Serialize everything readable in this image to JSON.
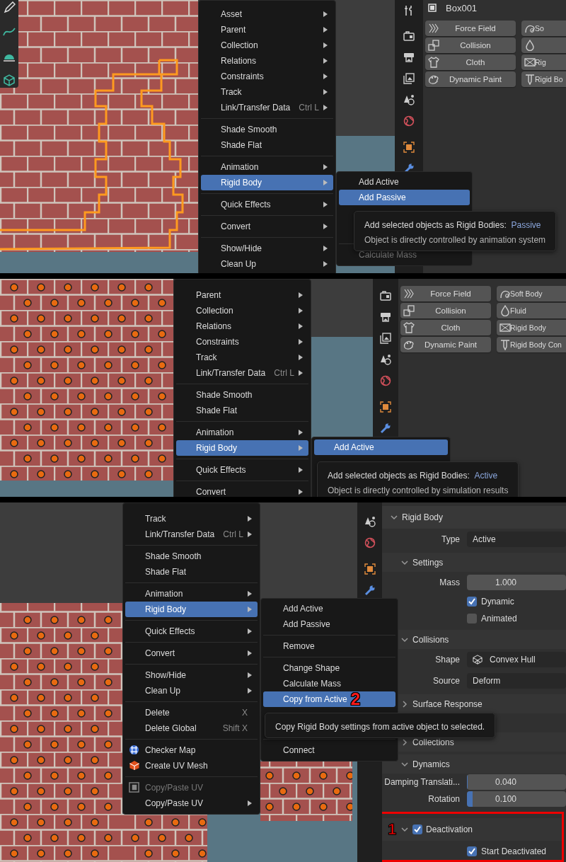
{
  "panels": [
    {
      "kind": "physics",
      "toolbar": {
        "tools": [
          {
            "kind": "pencil"
          },
          {
            "kind": "curve"
          },
          {
            "kind": "dome"
          },
          {
            "kind": "cube"
          }
        ]
      },
      "menu": {
        "groups": [
          [
            {
              "label": "Asset",
              "submenu": true,
              "selected": false
            },
            {
              "label": "Parent",
              "submenu": true,
              "selected": false
            },
            {
              "label": "Collection",
              "submenu": true,
              "selected": false
            },
            {
              "label": "Relations",
              "submenu": true,
              "selected": false
            },
            {
              "label": "Constraints",
              "submenu": true,
              "selected": false
            },
            {
              "label": "Track",
              "submenu": true,
              "selected": false
            },
            {
              "label": "Link/Transfer Data",
              "shortcut": "Ctrl L",
              "submenu": true,
              "selected": false
            }
          ],
          [
            {
              "label": "Shade Smooth",
              "submenu": false,
              "selected": false
            },
            {
              "label": "Shade Flat",
              "submenu": false,
              "selected": false
            }
          ],
          [
            {
              "label": "Animation",
              "submenu": true,
              "selected": false
            },
            {
              "label": "Rigid Body",
              "submenu": true,
              "selected": true
            }
          ],
          [
            {
              "label": "Quick Effects",
              "submenu": true,
              "selected": false
            }
          ],
          [
            {
              "label": "Convert",
              "submenu": true,
              "selected": false
            }
          ],
          [
            {
              "label": "Show/Hide",
              "submenu": true,
              "selected": false
            },
            {
              "label": "Clean Up",
              "submenu": true,
              "selected": false
            }
          ]
        ]
      },
      "submenu": {
        "groups": [
          [
            {
              "label": "Add Active",
              "submenu": false,
              "selected": false,
              "disabled": false
            },
            {
              "label": "Add Passive",
              "submenu": false,
              "selected": true,
              "disabled": false
            }
          ],
          [
            {
              "label": "Calculate Mass",
              "submenu": false,
              "selected": false,
              "disabled": true
            }
          ]
        ]
      },
      "tooltip": {
        "text": "Add selected objects as Rigid Bodies:",
        "value": "Passive",
        "description": "Object is directly controlled by animation system"
      },
      "properties": {
        "object_name": "Box001",
        "tabs": [
          {
            "kind": "tool"
          },
          {
            "kind": "render"
          },
          {
            "kind": "output"
          },
          {
            "kind": "view_layer"
          },
          {
            "kind": "scene"
          },
          {
            "kind": "world"
          },
          {
            "kind": "object"
          },
          {
            "kind": "modifier"
          }
        ],
        "physics_buttons": [
          {
            "label": "Force Field",
            "kind": "force_field"
          },
          {
            "label": "So",
            "kind": "soft_body"
          },
          {
            "label": "Collision",
            "kind": "collision"
          },
          {
            "kind": "fluid"
          },
          {
            "label": "Cloth",
            "kind": "cloth"
          },
          {
            "label": "Rig",
            "kind": "rigid_body"
          },
          {
            "label": "Dynamic Paint",
            "kind": "dynamic_paint"
          },
          {
            "label": "Rigid Bo",
            "kind": "rigid_body_constraint"
          }
        ]
      }
    },
    {
      "kind": "physics",
      "menu": {
        "groups": [
          [
            {
              "label": "Parent",
              "submenu": true,
              "selected": false
            },
            {
              "label": "Collection",
              "submenu": true,
              "selected": false
            },
            {
              "label": "Relations",
              "submenu": true,
              "selected": false
            },
            {
              "label": "Constraints",
              "submenu": true,
              "selected": false
            },
            {
              "label": "Track",
              "submenu": true,
              "selected": false
            },
            {
              "label": "Link/Transfer Data",
              "shortcut": "Ctrl L",
              "submenu": true,
              "selected": false
            }
          ],
          [
            {
              "label": "Shade Smooth",
              "submenu": false,
              "selected": false
            },
            {
              "label": "Shade Flat",
              "submenu": false,
              "selected": false
            }
          ],
          [
            {
              "label": "Animation",
              "submenu": true,
              "selected": false
            },
            {
              "label": "Rigid Body",
              "submenu": true,
              "selected": true
            }
          ],
          [
            {
              "label": "Quick Effects",
              "submenu": true,
              "selected": false
            }
          ],
          [
            {
              "label": "Convert",
              "submenu": true,
              "selected": false
            }
          ]
        ]
      },
      "submenu": {
        "groups": [
          [
            {
              "label": "Add Active",
              "submenu": false,
              "selected": true
            }
          ]
        ]
      },
      "tooltip": {
        "text": "Add selected objects as Rigid Bodies:",
        "value": "Active",
        "description": "Object is directly controlled by simulation results"
      },
      "properties": {
        "tabs": [
          {
            "kind": "render"
          },
          {
            "kind": "output"
          },
          {
            "kind": "view_layer"
          },
          {
            "kind": "scene"
          },
          {
            "kind": "world"
          },
          {
            "kind": "object"
          },
          {
            "kind": "modifier"
          }
        ],
        "physics_buttons": [
          {
            "label": "Force Field",
            "kind": "force_field"
          },
          {
            "label": "Soft Body",
            "kind": "soft_body"
          },
          {
            "label": "Collision",
            "kind": "collision"
          },
          {
            "label": "Fluid",
            "kind": "fluid"
          },
          {
            "label": "Cloth",
            "kind": "cloth"
          },
          {
            "label": "Rigid Body",
            "kind": "rigid_body"
          },
          {
            "label": "Dynamic Paint",
            "kind": "dynamic_paint"
          },
          {
            "label": "Rigid Body Con",
            "kind": "rigid_body_constraint"
          }
        ]
      }
    },
    {
      "kind": "rigid_body",
      "menu": {
        "groups": [
          [
            {
              "label": "Track",
              "kind": "plain",
              "submenu": true,
              "selected": false,
              "disabled": false
            },
            {
              "label": "Link/Transfer Data",
              "shortcut": "Ctrl L",
              "kind": "plain",
              "submenu": true,
              "selected": false,
              "disabled": false
            }
          ],
          [
            {
              "label": "Shade Smooth",
              "kind": "plain",
              "submenu": false,
              "selected": false,
              "disabled": false
            },
            {
              "label": "Shade Flat",
              "kind": "plain",
              "submenu": false,
              "selected": false,
              "disabled": false
            }
          ],
          [
            {
              "label": "Animation",
              "kind": "plain",
              "submenu": true,
              "selected": false,
              "disabled": false
            },
            {
              "label": "Rigid Body",
              "kind": "plain",
              "submenu": true,
              "selected": true,
              "disabled": false
            }
          ],
          [
            {
              "label": "Quick Effects",
              "kind": "plain",
              "submenu": true,
              "selected": false,
              "disabled": false
            }
          ],
          [
            {
              "label": "Convert",
              "kind": "plain",
              "submenu": true,
              "selected": false,
              "disabled": false
            }
          ],
          [
            {
              "label": "Show/Hide",
              "kind": "plain",
              "submenu": true,
              "selected": false,
              "disabled": false
            },
            {
              "label": "Clean Up",
              "kind": "plain",
              "submenu": true,
              "selected": false,
              "disabled": false
            }
          ],
          [
            {
              "label": "Delete",
              "shortcut": "X",
              "kind": "plain",
              "submenu": false,
              "selected": false,
              "disabled": false
            },
            {
              "label": "Delete Global",
              "shortcut": "Shift X",
              "kind": "plain",
              "submenu": false,
              "selected": false,
              "disabled": false
            }
          ],
          [
            {
              "label": "Checker Map",
              "kind": "checker_map",
              "submenu": false,
              "selected": false,
              "disabled": false
            },
            {
              "label": "Create UV Mesh",
              "kind": "uv_mesh",
              "submenu": false,
              "selected": false,
              "disabled": false
            }
          ],
          [
            {
              "label": "Copy/Paste UV",
              "kind": "uv_copy",
              "submenu": false,
              "selected": false,
              "disabled": true
            },
            {
              "label": "Copy/Paste UV",
              "kind": "plain",
              "submenu": true,
              "selected": false,
              "disabled": false
            }
          ]
        ]
      },
      "submenu": {
        "groups": [
          [
            {
              "label": "Add Active",
              "submenu": false,
              "selected": false
            },
            {
              "label": "Add Passive",
              "submenu": false,
              "selected": false
            }
          ],
          [
            {
              "label": "Remove",
              "submenu": false,
              "selected": false
            }
          ],
          [
            {
              "label": "Change Shape",
              "submenu": false,
              "selected": false
            },
            {
              "label": "Calculate Mass",
              "submenu": false,
              "selected": false
            },
            {
              "label": "Copy from Active",
              "submenu": false,
              "selected": true,
              "annotation": "2"
            }
          ],
          [
            {
              "label": "Connect",
              "submenu": false,
              "selected": false
            }
          ]
        ]
      },
      "tooltip": {
        "text": "Copy Rigid Body settings from active object to selected."
      },
      "properties": {
        "tabs": [
          {
            "kind": "scene"
          },
          {
            "kind": "world"
          },
          {
            "kind": "object"
          },
          {
            "kind": "modifier"
          }
        ],
        "rows": [
          {
            "kind": "section",
            "label": "Rigid Body",
            "expanded": true
          },
          {
            "kind": "dropdown",
            "label": "Type",
            "value": "Active"
          },
          {
            "kind": "subsection",
            "label": "Settings",
            "expanded": true
          },
          {
            "kind": "number",
            "label": "Mass",
            "value": "1.000"
          },
          {
            "kind": "checkbox",
            "label": "Dynamic",
            "checked": true
          },
          {
            "kind": "checkbox",
            "label": "Animated",
            "checked": false
          },
          {
            "kind": "subsection",
            "label": "Collisions",
            "expanded": true
          },
          {
            "kind": "shape_dropdown",
            "label": "Shape",
            "value": "Convex Hull"
          },
          {
            "kind": "dropdown",
            "label": "Source",
            "value": "Deform"
          },
          {
            "kind": "subsection",
            "label": "Surface Response",
            "expanded": false
          },
          {
            "kind": "subsection",
            "label": "Collections",
            "expanded": false
          },
          {
            "kind": "subsection",
            "label": "Dynamics",
            "expanded": true
          },
          {
            "kind": "slider",
            "label": "Damping Translati...",
            "value": "0.040",
            "level": 0.01
          },
          {
            "kind": "slider",
            "label": "Rotation",
            "value": "0.100",
            "level": 0.06
          },
          {
            "kind": "checkbox_subsection",
            "label": "Deactivation",
            "checked": true,
            "expanded": true,
            "framed": true,
            "annotation": "1"
          },
          {
            "kind": "checkbox",
            "label": "Start Deactivated",
            "checked": true,
            "framed": true
          }
        ]
      }
    }
  ]
}
